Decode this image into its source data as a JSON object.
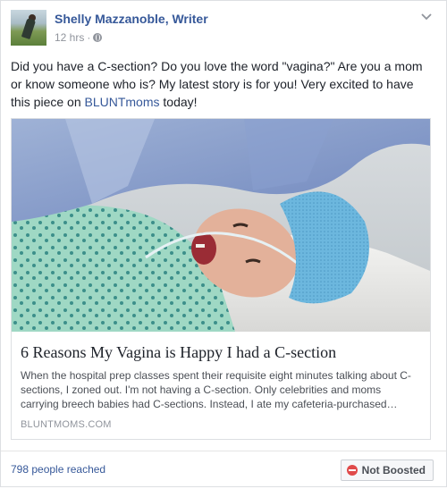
{
  "post": {
    "author": "Shelly Mazzanoble, Writer",
    "time": "12 hrs",
    "separator": "·",
    "text_before_link": "Did you have a C-section? Do you love the word \"vagina?\" Are you a mom or know someone who is? My latest story is for you! Very excited to have this piece on ",
    "link_text": "BLUNTmoms",
    "text_after_link": " today!"
  },
  "link_preview": {
    "title": "6 Reasons My Vagina is Happy I had a C-section",
    "description": "When the hospital prep classes spent their requisite eight minutes talking about C-sections, I zoned out. I'm not having a C-section. Only celebrities and moms carrying breech babies had C-sections. Instead, I ate my cafeteria-purchased…",
    "domain": "BLUNTMOMS.COM"
  },
  "footer": {
    "reach": "798 people reached",
    "boost_label": "Not Boosted"
  },
  "icons": {
    "privacy": "globe-icon",
    "menu": "chevron-down-icon",
    "boost": "no-entry-icon"
  },
  "colors": {
    "link_blue": "#365899",
    "meta_gray": "#90949c",
    "boost_red": "#e04a4a"
  }
}
